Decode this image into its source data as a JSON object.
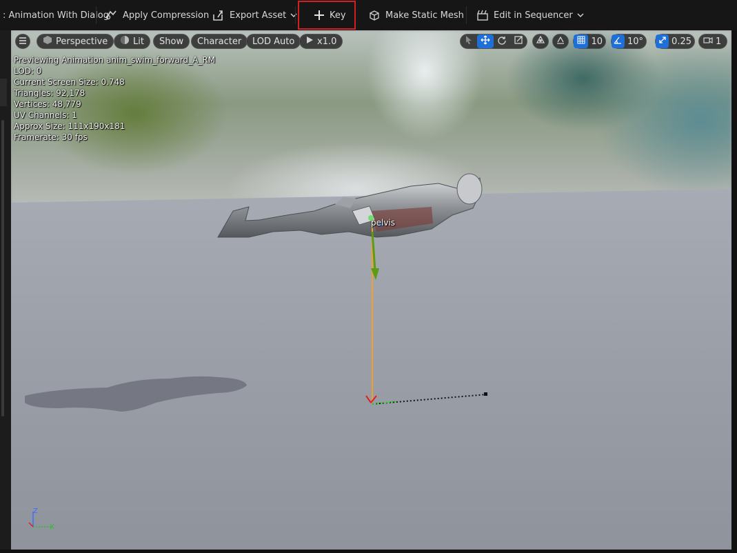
{
  "toolbar": {
    "items": [
      {
        "label": ": Animation With Dialog",
        "icon": "none"
      },
      {
        "label": "Apply Compression",
        "icon": "compression-icon"
      },
      {
        "label": "Export Asset",
        "icon": "export-icon"
      },
      {
        "label": "Key",
        "icon": "plus-icon"
      },
      {
        "label": "Make Static Mesh",
        "icon": "static-mesh-icon"
      },
      {
        "label": "Edit in Sequencer",
        "icon": "sequencer-icon"
      }
    ],
    "highlight_color": "#d21f1f"
  },
  "viewport": {
    "menu_icon": "hamburger-icon",
    "perspective": "Perspective",
    "lit": "Lit",
    "show": "Show",
    "character": "Character",
    "lod": "LOD Auto",
    "play_speed": "x1.0",
    "grid_snap": "10",
    "rotation_snap": "10°",
    "scale_snap": "0.25",
    "camera_speed": "1",
    "accent": "#1f6fd6"
  },
  "stats": {
    "line1": "Previewing Animation anim_swim_forward_A_RM",
    "line2": "LOD: 0",
    "line3": "Current Screen Size: 0.748",
    "line4": "Triangles: 92,178",
    "line5": "Vertices: 48,779",
    "line6": "UV Channels: 1",
    "line7": "Approx Size: 111x190x181",
    "line8": "Framerate: 30 fps"
  },
  "scene": {
    "bone_label": "pelvis",
    "axis_z": "Z",
    "axis_x": "X"
  }
}
